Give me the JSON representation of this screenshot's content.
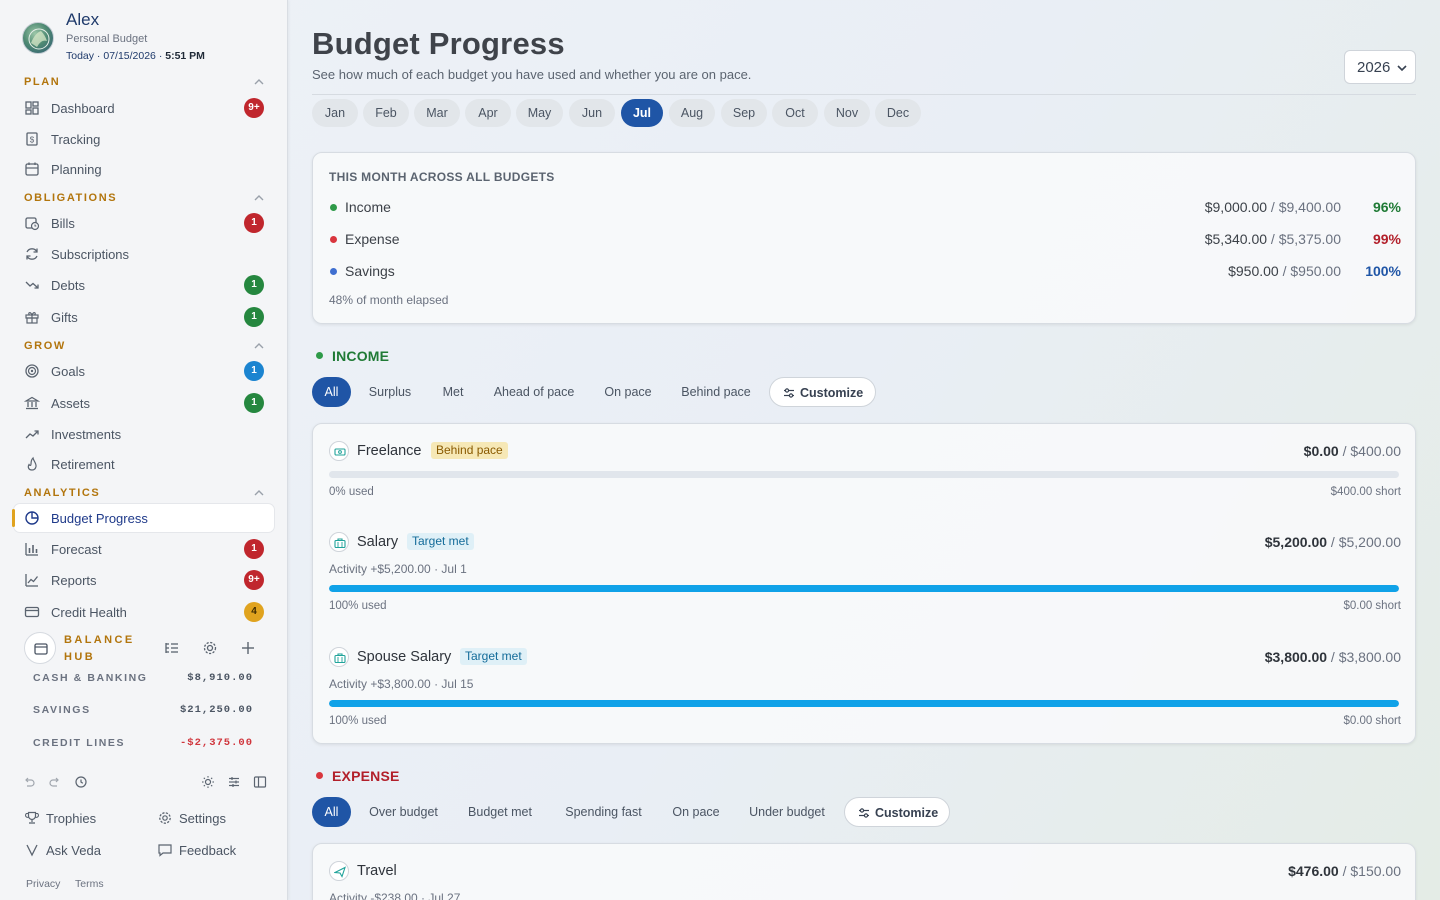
{
  "profile": {
    "name": "Alex",
    "subtitle": "Personal Budget",
    "date_prefix": "Today · 07/15/2026 ·",
    "time": "5:51 PM"
  },
  "sidebar": {
    "sections": [
      {
        "title": "PLAN",
        "items": [
          {
            "label": "Dashboard",
            "icon": "dashboard-icon",
            "badge": "9+",
            "badge_color": "red"
          },
          {
            "label": "Tracking",
            "icon": "receipt-icon"
          },
          {
            "label": "Planning",
            "icon": "calendar-icon"
          }
        ]
      },
      {
        "title": "OBLIGATIONS",
        "items": [
          {
            "label": "Bills",
            "icon": "calendar-clock-icon",
            "badge": "1",
            "badge_color": "red"
          },
          {
            "label": "Subscriptions",
            "icon": "refresh-icon"
          },
          {
            "label": "Debts",
            "icon": "trending-down-icon",
            "badge": "1",
            "badge_color": "green"
          },
          {
            "label": "Gifts",
            "icon": "gift-icon",
            "badge": "1",
            "badge_color": "green"
          }
        ]
      },
      {
        "title": "GROW",
        "items": [
          {
            "label": "Goals",
            "icon": "target-icon",
            "badge": "1",
            "badge_color": "blue"
          },
          {
            "label": "Assets",
            "icon": "bank-icon",
            "badge": "1",
            "badge_color": "green"
          },
          {
            "label": "Investments",
            "icon": "trending-up-icon"
          },
          {
            "label": "Retirement",
            "icon": "flame-icon"
          }
        ]
      },
      {
        "title": "ANALYTICS",
        "items": [
          {
            "label": "Budget Progress",
            "icon": "pie-chart-icon",
            "active": true
          },
          {
            "label": "Forecast",
            "icon": "bar-chart-icon",
            "badge": "1",
            "badge_color": "red"
          },
          {
            "label": "Reports",
            "icon": "line-chart-icon",
            "badge": "9+",
            "badge_color": "red"
          },
          {
            "label": "Credit Health",
            "icon": "credit-card-icon",
            "badge": "4",
            "badge_color": "yellow"
          }
        ]
      }
    ],
    "balance_hub": {
      "title": "BALANCE HUB",
      "rows": [
        {
          "label": "CASH & BANKING",
          "value": "$8,910.00"
        },
        {
          "label": "SAVINGS",
          "value": "$21,250.00"
        },
        {
          "label": "CREDIT LINES",
          "value": "-$2,375.00",
          "negative": true
        }
      ]
    },
    "footer": {
      "items": [
        {
          "label": "Trophies",
          "icon": "trophy-icon"
        },
        {
          "label": "Settings",
          "icon": "gear-icon"
        },
        {
          "label": "Ask Veda",
          "icon": "veda-icon"
        },
        {
          "label": "Feedback",
          "icon": "chat-icon"
        }
      ],
      "privacy": "Privacy",
      "terms": "Terms"
    }
  },
  "main": {
    "title": "Budget Progress",
    "subtitle": "See how much of each budget you have used and whether you are on pace.",
    "year": "2026",
    "months": [
      "Jan",
      "Feb",
      "Mar",
      "Apr",
      "May",
      "Jun",
      "Jul",
      "Aug",
      "Sep",
      "Oct",
      "Nov",
      "Dec"
    ],
    "active_month": "Jul",
    "summary": {
      "heading": "THIS MONTH ACROSS ALL BUDGETS",
      "rows": [
        {
          "label": "Income",
          "actual": "$9,000.00",
          "budget": "$9,400.00",
          "pct": "96%",
          "color": "#2e9a48",
          "pct_color": "#1f7a35"
        },
        {
          "label": "Expense",
          "actual": "$5,340.00",
          "budget": "$5,375.00",
          "pct": "99%",
          "color": "#d9363e",
          "pct_color": "#b21f2a"
        },
        {
          "label": "Savings",
          "actual": "$950.00",
          "budget": "$950.00",
          "pct": "100%",
          "color": "#3f6fd0",
          "pct_color": "#1f55a6"
        }
      ],
      "elapsed": "48% of month elapsed"
    },
    "income": {
      "title": "INCOME",
      "color": "#1f7a35",
      "filters": [
        "All",
        "Surplus",
        "Met",
        "Ahead of pace",
        "On pace",
        "Behind pace"
      ],
      "customize": "Customize",
      "items": [
        {
          "name": "Freelance",
          "tag": "Behind pace",
          "tag_type": "behind",
          "actual": "$0.00",
          "budget": "$400.00",
          "activity": "",
          "used": "0% used",
          "short": "$400.00 short",
          "fill_pct": 0,
          "icon": "cash-icon"
        },
        {
          "name": "Salary",
          "tag": "Target met",
          "tag_type": "met",
          "actual": "$5,200.00",
          "budget": "$5,200.00",
          "activity": "Activity +$5,200.00 · Jul 1",
          "used": "100% used",
          "short": "$0.00 short",
          "fill_pct": 100,
          "icon": "briefcase-icon"
        },
        {
          "name": "Spouse Salary",
          "tag": "Target met",
          "tag_type": "met",
          "actual": "$3,800.00",
          "budget": "$3,800.00",
          "activity": "Activity +$3,800.00 · Jul 15",
          "used": "100% used",
          "short": "$0.00 short",
          "fill_pct": 100,
          "icon": "briefcase-icon"
        }
      ]
    },
    "expense": {
      "title": "EXPENSE",
      "color": "#b21f2a",
      "filters": [
        "All",
        "Over budget",
        "Budget met",
        "Spending fast",
        "On pace",
        "Under budget"
      ],
      "customize": "Customize",
      "items": [
        {
          "name": "Travel",
          "actual": "$476.00",
          "budget": "$150.00",
          "activity": "Activity -$238.00 · Jul 27",
          "icon": "plane-icon"
        }
      ]
    }
  },
  "colors": {
    "accent": "#1f55a6",
    "section_header": "#b2750d",
    "progress_fill": "#10a2e8"
  }
}
